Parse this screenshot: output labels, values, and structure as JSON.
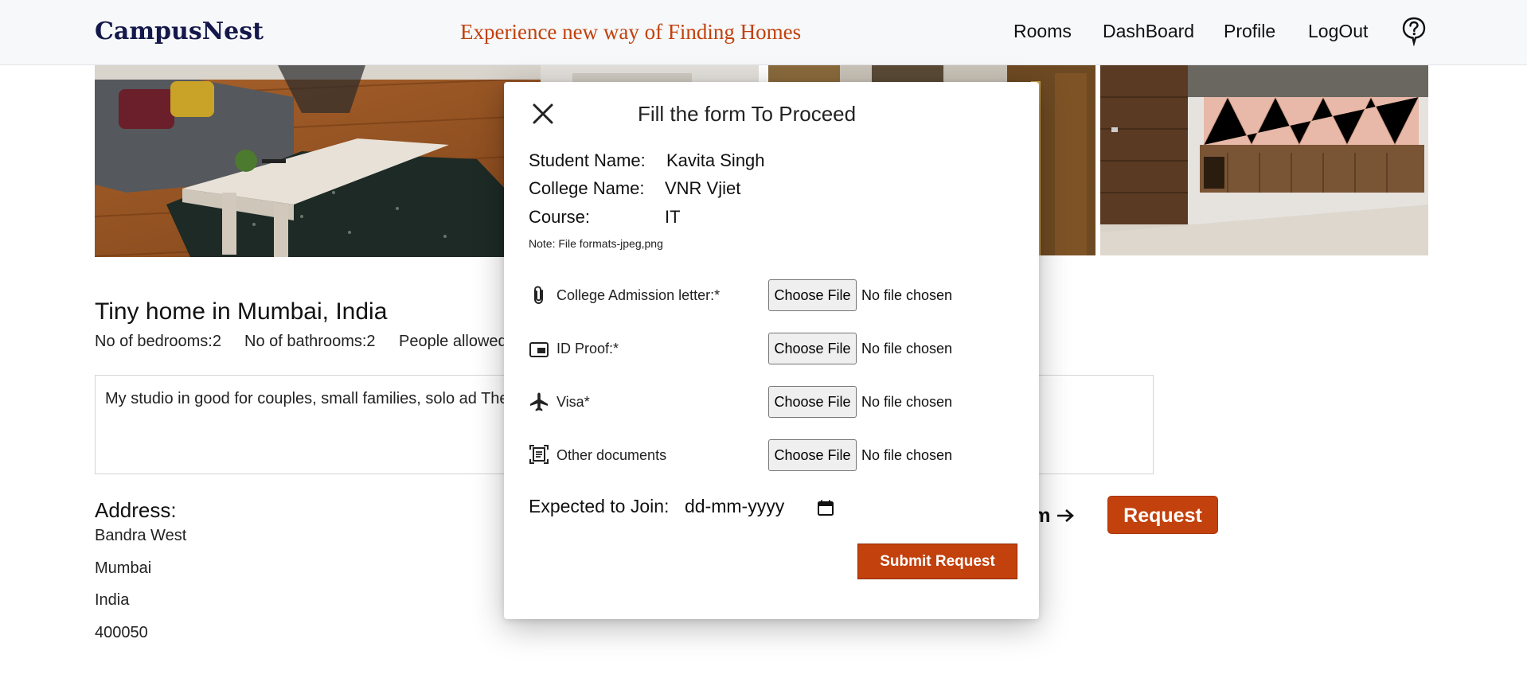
{
  "header": {
    "logo": "CampusNest",
    "tagline": "Experience new way of Finding Homes",
    "nav": [
      "Rooms",
      "DashBoard",
      "Profile",
      "LogOut"
    ],
    "help_icon": "question-circle-icon"
  },
  "listing": {
    "title": "Tiny home in Mumbai, India",
    "bedrooms": "No of bedrooms:2",
    "bathrooms": "No of bathrooms:2",
    "people": "People allowed",
    "description": "My studio in good for couples, small families, solo ad The neighbourhood is very safe and easy to access.",
    "address_title": "Address:",
    "address_lines": [
      "Bandra West",
      "Mumbai",
      "India",
      "400050"
    ],
    "room_link": "om",
    "request_button": "Request"
  },
  "modal": {
    "title": "Fill the form To Proceed",
    "close_icon": "close-icon",
    "student_label": "Student Name:",
    "student_value": "Kavita Singh",
    "college_label": "College Name:",
    "college_value": "VNR Vjiet",
    "course_label": "Course:",
    "course_value": "IT",
    "note": "Note: File formats-jpeg,png",
    "documents": [
      {
        "label": "College Admission letter:*",
        "icon": "paperclip-icon",
        "button": "Choose File",
        "status": "No file chosen"
      },
      {
        "label": "ID Proof:*",
        "icon": "id-card-icon",
        "button": "Choose File",
        "status": "No file chosen"
      },
      {
        "label": "Visa*",
        "icon": "airplane-icon",
        "button": "Choose File",
        "status": "No file chosen"
      },
      {
        "label": "Other documents",
        "icon": "document-scan-icon",
        "button": "Choose File",
        "status": "No file chosen"
      }
    ],
    "join_label": "Expected to Join:",
    "join_placeholder": "dd-mm-yyyy",
    "submit": "Submit Request"
  },
  "colors": {
    "accent": "#c2410c",
    "logo": "#14184a"
  }
}
